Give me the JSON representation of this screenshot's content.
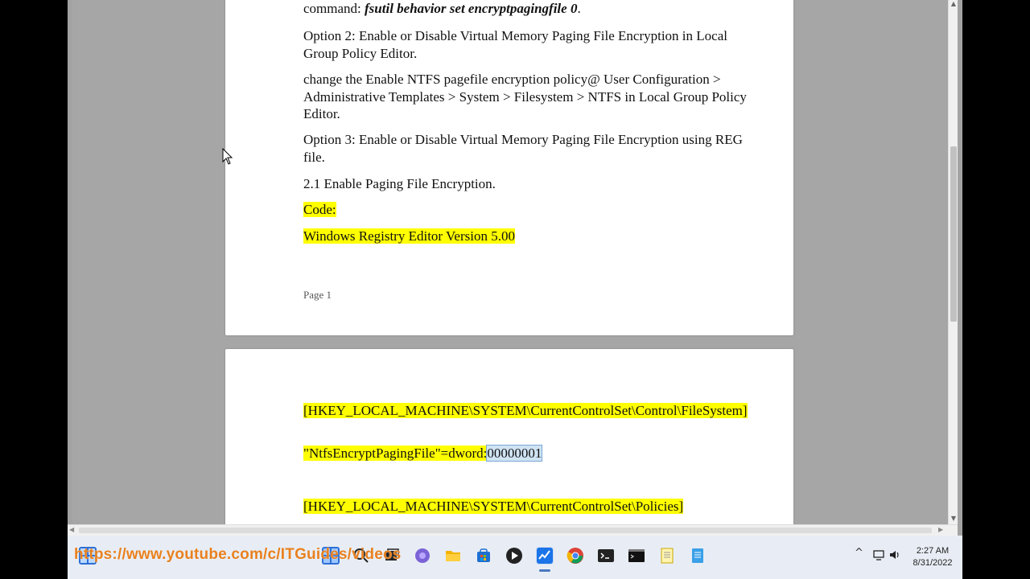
{
  "document": {
    "page1": {
      "line_command_prefix": "command: ",
      "line_command_code": "fsutil behavior set encryptpagingfile 0",
      "line_command_suffix": ".",
      "option2": "Option 2: Enable or Disable Virtual Memory Paging File Encryption in Local Group Policy Editor.",
      "change_policy": "change the Enable NTFS pagefile encryption policy@ User Configuration > Administrative Templates > System > Filesystem > NTFS in Local Group Policy Editor.",
      "option3": "Option 3: Enable or Disable Virtual Memory Paging File Encryption using REG file.",
      "step_2_1": "2.1 Enable Paging File Encryption.",
      "code_label": "Code:",
      "registry_version": "Windows Registry Editor Version 5.00",
      "page_number": "Page 1"
    },
    "page2": {
      "key_filesystem": "[HKEY_LOCAL_MACHINE\\SYSTEM\\CurrentControlSet\\Control\\FileSystem]",
      "value_prefix": "\"NtfsEncryptPagingFile\"=dword:",
      "value_selected": "00000001",
      "key_policies": "[HKEY_LOCAL_MACHINE\\SYSTEM\\CurrentControlSet\\Policies]"
    }
  },
  "taskbar": {
    "overlay_url": "https://www.youtube.com/c/ITGuides/videos",
    "icons": [
      "start-icon",
      "search-icon",
      "task-view-icon",
      "chat-icon",
      "file-explorer-icon",
      "store-icon",
      "media-player-icon",
      "activity-app-icon",
      "chrome-icon",
      "terminal-icon",
      "command-prompt-icon",
      "notepad-icon",
      "notes-app-icon"
    ],
    "tray": {
      "chevron": "^",
      "time": "2:27 AM",
      "date": "8/31/2022"
    }
  }
}
